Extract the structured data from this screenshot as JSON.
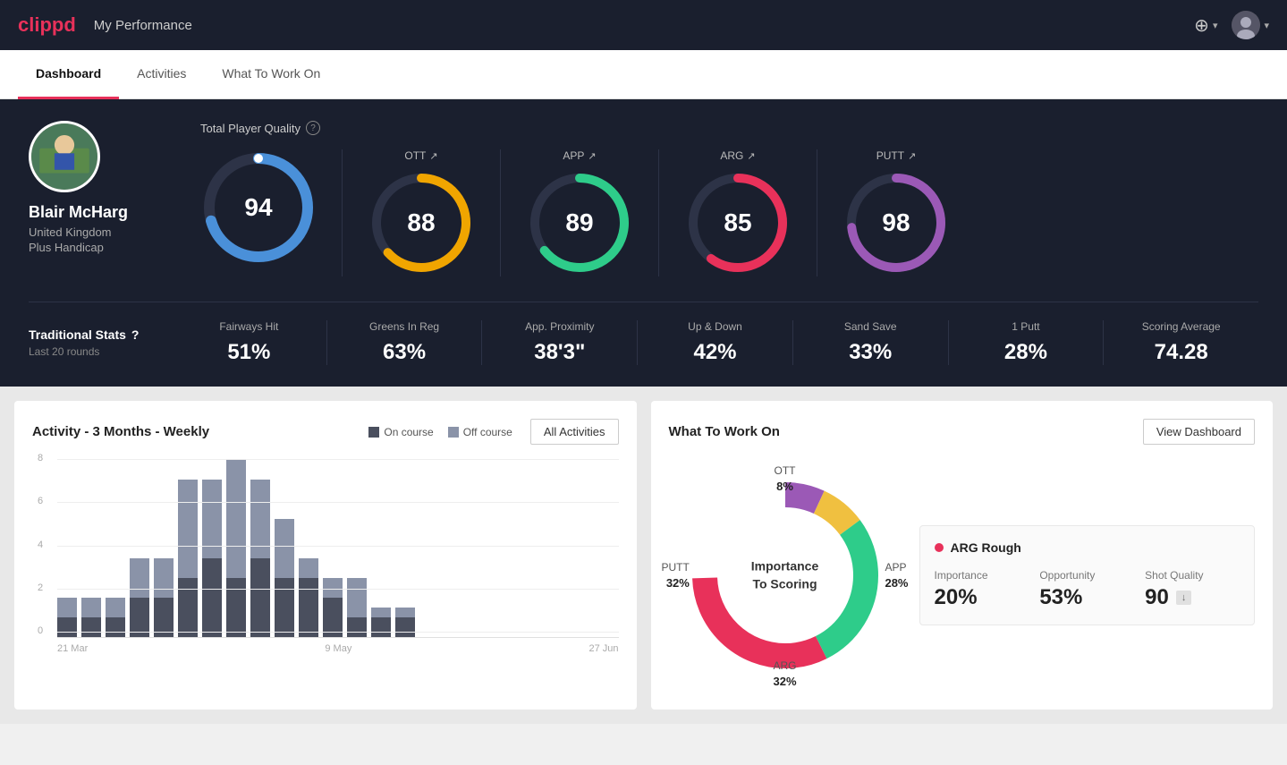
{
  "header": {
    "logo": "clippd",
    "title": "My Performance",
    "add_icon": "⊕",
    "avatar_label": "User Avatar"
  },
  "tabs": [
    {
      "label": "Dashboard",
      "active": true
    },
    {
      "label": "Activities",
      "active": false
    },
    {
      "label": "What To Work On",
      "active": false
    }
  ],
  "player": {
    "name": "Blair McHarg",
    "country": "United Kingdom",
    "handicap": "Plus Handicap"
  },
  "quality": {
    "label": "Total Player Quality",
    "scores": [
      {
        "key": "total",
        "value": "94",
        "color_start": "#4a90d9",
        "color_end": "#4a90d9",
        "label": "",
        "pct": 94
      },
      {
        "key": "ott",
        "label": "OTT",
        "value": "88",
        "color": "#f0a500",
        "pct": 88
      },
      {
        "key": "app",
        "label": "APP",
        "value": "89",
        "color": "#2ecc8a",
        "pct": 89
      },
      {
        "key": "arg",
        "label": "ARG",
        "value": "85",
        "color": "#e8315a",
        "pct": 85
      },
      {
        "key": "putt",
        "label": "PUTT",
        "value": "98",
        "color": "#9b59b6",
        "pct": 98
      }
    ]
  },
  "traditional_stats": {
    "title": "Traditional Stats",
    "subtitle": "Last 20 rounds",
    "items": [
      {
        "label": "Fairways Hit",
        "value": "51%"
      },
      {
        "label": "Greens In Reg",
        "value": "63%"
      },
      {
        "label": "App. Proximity",
        "value": "38'3\""
      },
      {
        "label": "Up & Down",
        "value": "42%"
      },
      {
        "label": "Sand Save",
        "value": "33%"
      },
      {
        "label": "1 Putt",
        "value": "28%"
      },
      {
        "label": "Scoring Average",
        "value": "74.28"
      }
    ]
  },
  "activity_chart": {
    "title": "Activity - 3 Months - Weekly",
    "legend": [
      {
        "label": "On course",
        "color": "#4a4f5e"
      },
      {
        "label": "Off course",
        "color": "#8a93a8"
      }
    ],
    "btn_label": "All Activities",
    "x_labels": [
      "21 Mar",
      "9 May",
      "27 Jun"
    ],
    "bars": [
      {
        "on": 1,
        "off": 1
      },
      {
        "on": 1,
        "off": 1
      },
      {
        "on": 1,
        "off": 1
      },
      {
        "on": 2,
        "off": 2
      },
      {
        "on": 2,
        "off": 2
      },
      {
        "on": 3,
        "off": 5
      },
      {
        "on": 4,
        "off": 4
      },
      {
        "on": 3,
        "off": 6
      },
      {
        "on": 4,
        "off": 4
      },
      {
        "on": 3,
        "off": 3
      },
      {
        "on": 3,
        "off": 1
      },
      {
        "on": 2,
        "off": 1
      },
      {
        "on": 1,
        "off": 2
      },
      {
        "on": 1,
        "off": 0.5
      },
      {
        "on": 1,
        "off": 0.5
      }
    ],
    "y_labels": [
      "0",
      "2",
      "4",
      "6",
      "8"
    ]
  },
  "what_to_work_on": {
    "title": "What To Work On",
    "btn_label": "View Dashboard",
    "donut_center": [
      "Importance",
      "To Scoring"
    ],
    "segments": [
      {
        "label": "OTT",
        "pct": "8%",
        "color": "#f0c040",
        "position": "top"
      },
      {
        "label": "APP",
        "pct": "28%",
        "color": "#2ecc8a",
        "position": "right"
      },
      {
        "label": "ARG",
        "pct": "32%",
        "color": "#e8315a",
        "position": "bottom"
      },
      {
        "label": "PUTT",
        "pct": "32%",
        "color": "#9b59b6",
        "position": "left"
      }
    ],
    "info_card": {
      "title": "ARG Rough",
      "dot_color": "#e8315a",
      "metrics": [
        {
          "label": "Importance",
          "value": "20%"
        },
        {
          "label": "Opportunity",
          "value": "53%"
        },
        {
          "label": "Shot Quality",
          "value": "90",
          "badge": "↓"
        }
      ]
    }
  }
}
